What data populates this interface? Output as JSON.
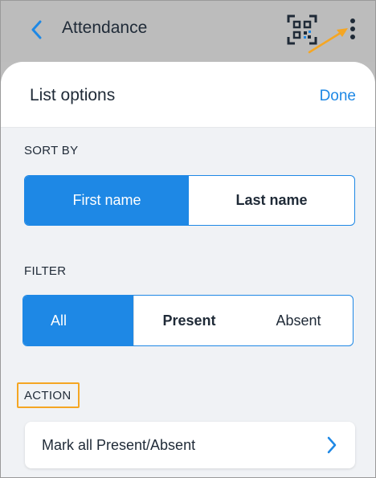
{
  "appbar": {
    "title": "Attendance",
    "back_icon": "chevron-left-icon",
    "qr_icon": "qr-code-scan-icon",
    "more_icon": "more-vertical-icon"
  },
  "sheet": {
    "title": "List options",
    "done_label": "Done"
  },
  "sort_by": {
    "label": "SORT BY",
    "options": [
      "First name",
      "Last name"
    ],
    "selected": "First name"
  },
  "filter": {
    "label": "FILTER",
    "options": [
      "All",
      "Present",
      "Absent"
    ],
    "selected": "All"
  },
  "action": {
    "label": "ACTION",
    "item_label": "Mark all Present/Absent",
    "item_icon": "chevron-right-icon"
  },
  "colors": {
    "accent": "#1e88e5",
    "highlight": "#f5a623",
    "appbar_bg": "#bcbcbc",
    "sheet_bg": "#f0f2f5"
  }
}
